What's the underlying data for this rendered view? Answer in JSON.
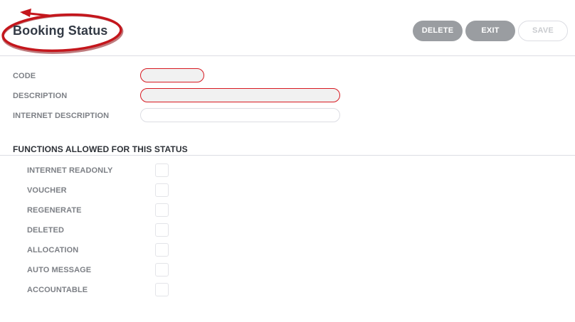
{
  "header": {
    "title": "Booking Status",
    "buttons": {
      "delete": "DELETE",
      "exit": "EXIT",
      "save": "SAVE"
    }
  },
  "form": {
    "code_label": "CODE",
    "code_value": "",
    "description_label": "DESCRIPTION",
    "description_value": "",
    "internet_description_label": "INTERNET DESCRIPTION",
    "internet_description_value": ""
  },
  "functions": {
    "title": "FUNCTIONS ALLOWED FOR THIS STATUS",
    "items": [
      {
        "label": "INTERNET READONLY",
        "checked": false
      },
      {
        "label": "VOUCHER",
        "checked": false
      },
      {
        "label": "REGENERATE",
        "checked": false
      },
      {
        "label": "DELETED",
        "checked": false
      },
      {
        "label": "ALLOCATION",
        "checked": false
      },
      {
        "label": "AUTO MESSAGE",
        "checked": false
      },
      {
        "label": "ACCOUNTABLE",
        "checked": false
      }
    ]
  },
  "colors": {
    "required_border": "#d71921",
    "button_gray": "#9a9da1",
    "annotation_red": "#c4161c"
  }
}
